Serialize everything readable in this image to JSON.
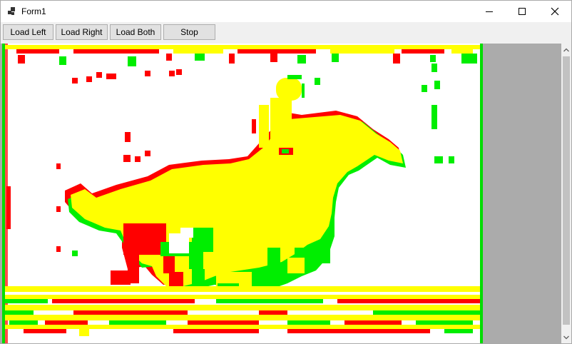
{
  "window": {
    "title": "Form1"
  },
  "toolbar": {
    "load_left": "Load Left",
    "load_right": "Load Right",
    "load_both": "Load Both",
    "stop": "Stop"
  },
  "icons": {
    "app": "app-icon",
    "minimize": "minimize-icon",
    "maximize": "maximize-icon",
    "close": "close-icon",
    "scroll_up": "chevron-up-icon",
    "scroll_down": "chevron-down-icon"
  },
  "colors": {
    "left_only": "#ff0000",
    "right_only": "#00ff00",
    "overlap": "#ffff00",
    "background": "#ffffff"
  }
}
